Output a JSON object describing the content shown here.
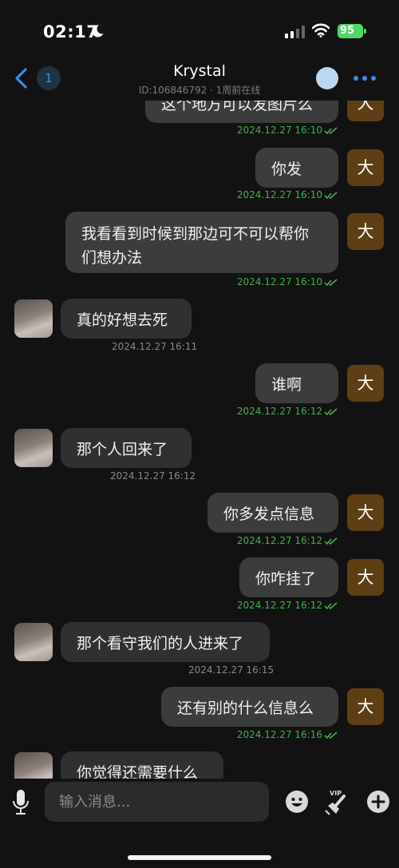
{
  "status": {
    "time": "02:17",
    "battery": "95"
  },
  "header": {
    "unread": "1",
    "name": "Krystal",
    "subtitle": "ID:106846792 · 1周前在线"
  },
  "self_avatar_char": "大",
  "messages": [
    {
      "dir": "out",
      "text": "这个地方可以发图片么",
      "time": "2024.12.27 16:10"
    },
    {
      "dir": "out",
      "text": "你发",
      "time": "2024.12.27 16:10"
    },
    {
      "dir": "out",
      "text": "我看看到时候到那边可不可以帮你们想办法",
      "time": "2024.12.27 16:10"
    },
    {
      "dir": "in",
      "text": "真的好想去死",
      "time": "2024.12.27 16:11"
    },
    {
      "dir": "out",
      "text": "谁啊",
      "time": "2024.12.27 16:12"
    },
    {
      "dir": "in",
      "text": "那个人回来了",
      "time": "2024.12.27 16:12"
    },
    {
      "dir": "out",
      "text": "你多发点信息",
      "time": "2024.12.27 16:12"
    },
    {
      "dir": "out",
      "text": "你咋挂了",
      "time": "2024.12.27 16:12"
    },
    {
      "dir": "in",
      "text": "那个看守我们的人进来了",
      "time": "2024.12.27 16:15"
    },
    {
      "dir": "out",
      "text": "还有别的什么信息么",
      "time": "2024.12.27 16:16"
    },
    {
      "dir": "in",
      "text": "你觉得还需要什么",
      "time": ""
    }
  ],
  "composer": {
    "placeholder": "输入消息..."
  },
  "colors": {
    "accent": "#3b8df0",
    "sent_check": "#45b24d",
    "self_avatar": "#5e3e14"
  }
}
